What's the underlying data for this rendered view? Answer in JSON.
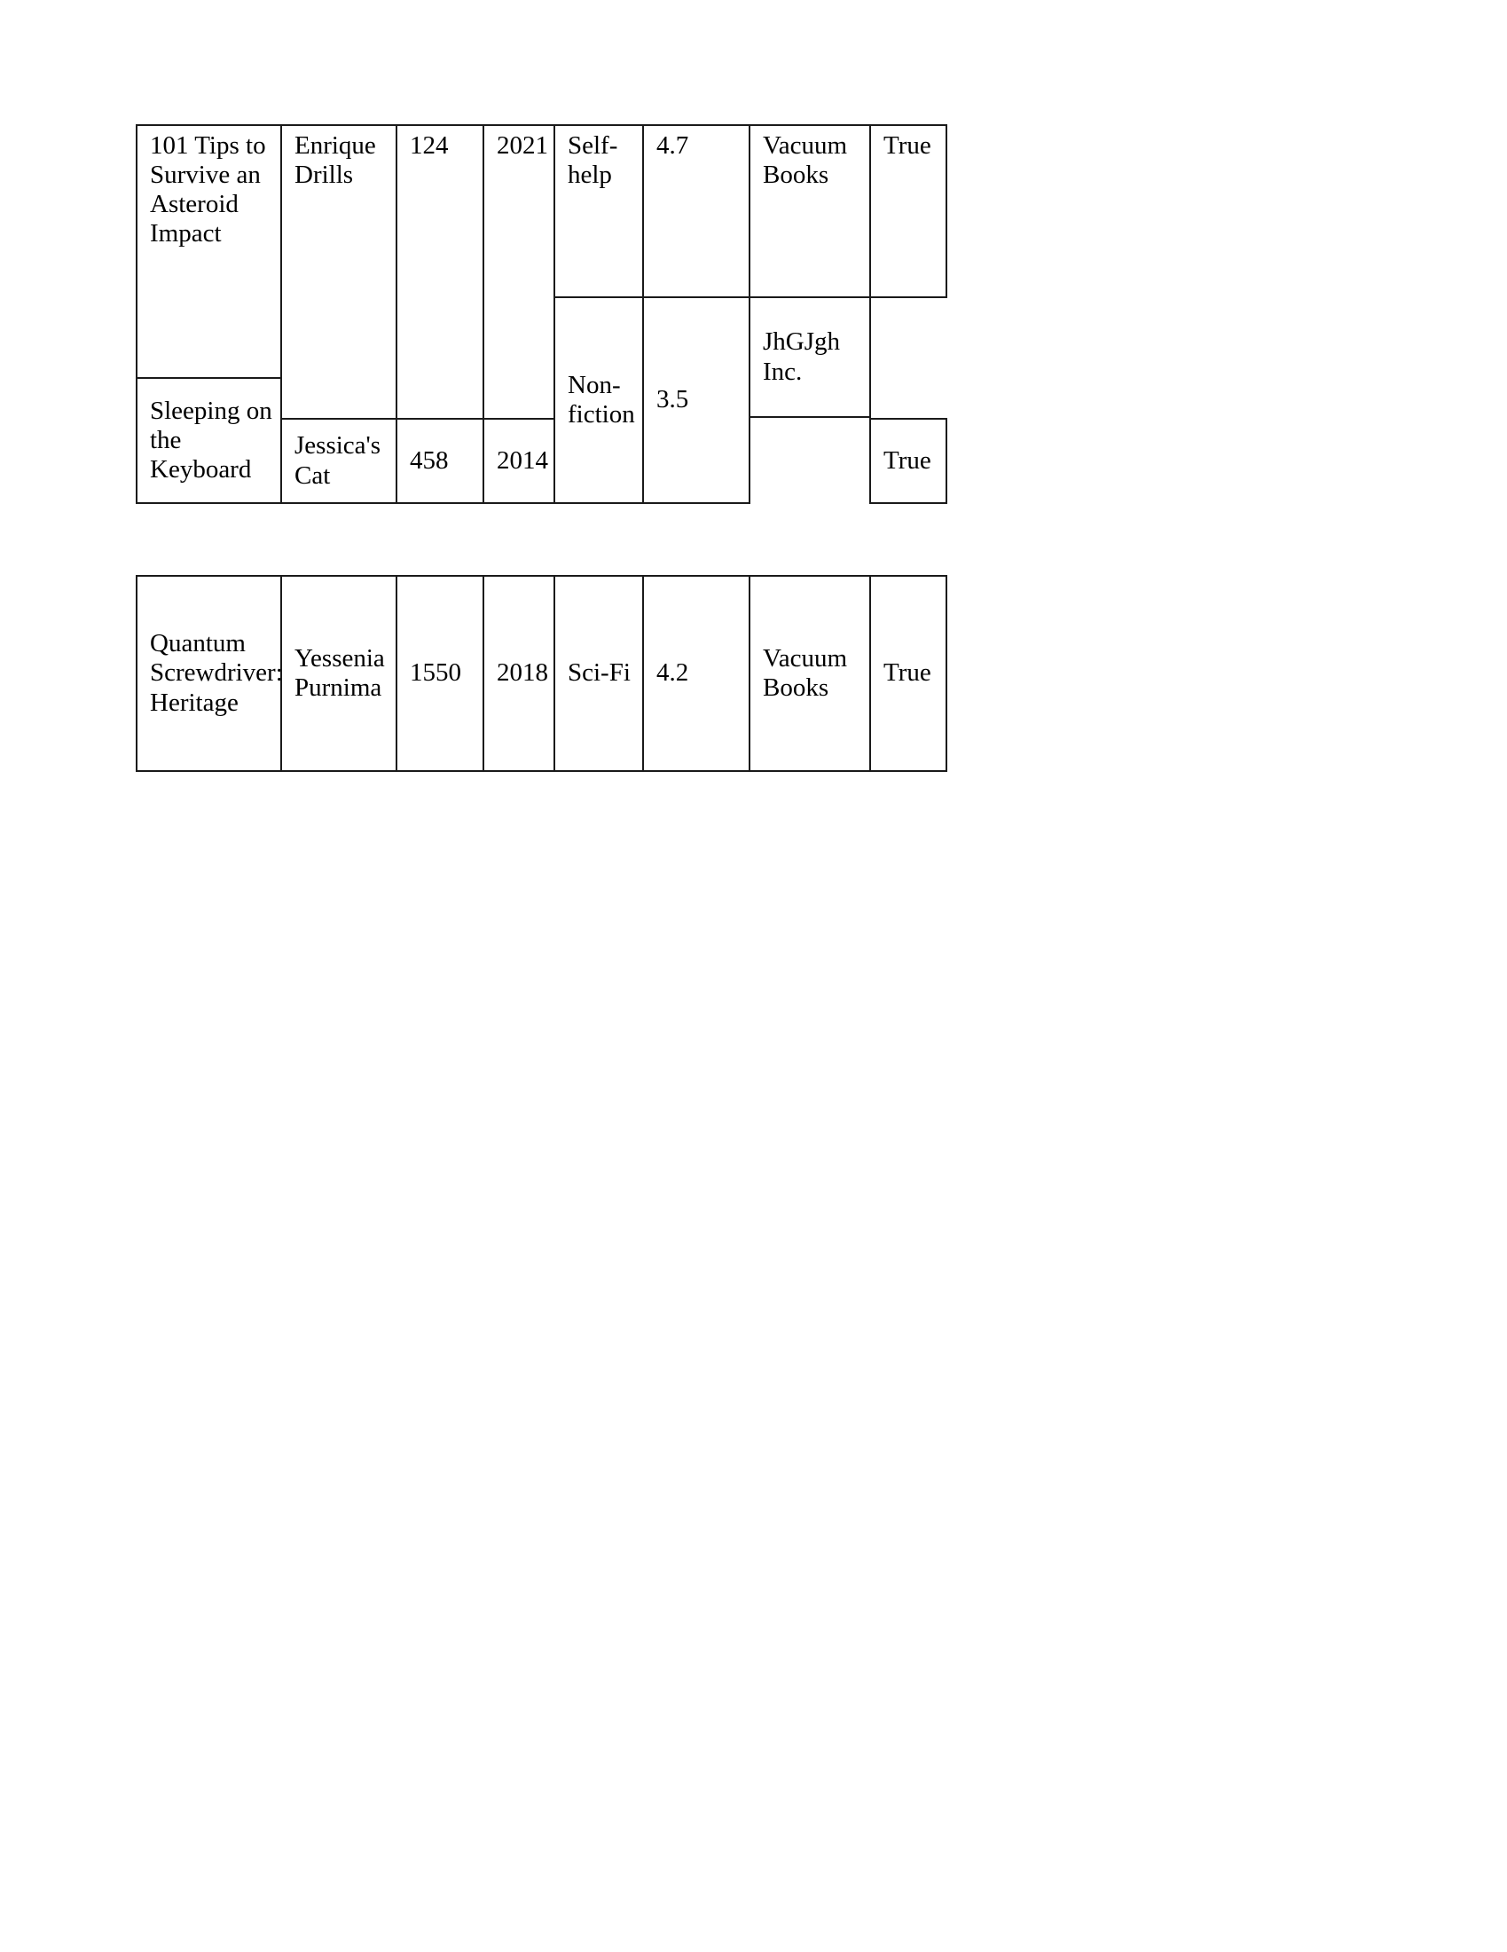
{
  "document": {
    "type": "table-document",
    "page_background": "#ffffff",
    "text_color": "#000000",
    "border_color": "#1a1a1a"
  },
  "table": {
    "name": "book-inventory-table",
    "column_count": 8,
    "row_count": 3,
    "has_header_row": false,
    "columns": [
      "title",
      "author",
      "pages",
      "year",
      "genre",
      "rating",
      "publisher",
      "in_stock"
    ],
    "rows": [
      {
        "title": "101 Tips to Survive an Asteroid Impact",
        "author": "Enrique Drills",
        "pages": "124",
        "year": "2021",
        "genre": "Self-help",
        "rating": "4.7",
        "publisher": "Vacuum Books",
        "in_stock": "True"
      },
      {
        "title": "Sleeping on the Keyboard",
        "author": "Jessica's Cat",
        "pages": "458",
        "year": "2014",
        "genre": "Non-fiction",
        "rating": "3.5",
        "publisher": "JhGJgh Inc.",
        "in_stock": "True"
      },
      {
        "title": "Quantum Screwdriver: Heritage",
        "author": "Yessenia Purnima",
        "pages": "1550",
        "year": "2018",
        "genre": "Sci-Fi",
        "rating": "4.2",
        "publisher": "Vacuum Books",
        "in_stock": "True"
      }
    ]
  }
}
